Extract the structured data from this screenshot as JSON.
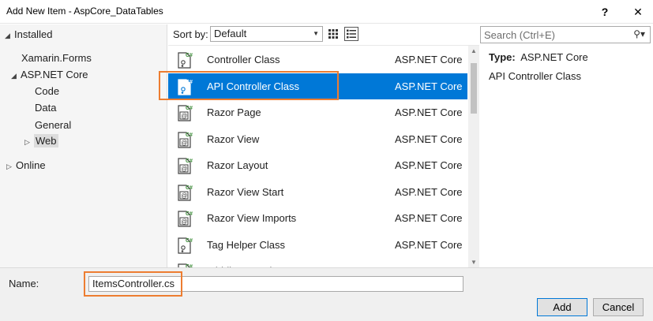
{
  "window": {
    "title": "Add New Item - AspCore_DataTables",
    "help_label": "?",
    "close_label": "✕"
  },
  "tree": {
    "installed": "Installed",
    "items": [
      "Xamarin.Forms",
      "ASP.NET Core",
      "Code",
      "Data",
      "General",
      "Web"
    ],
    "selected": "Web",
    "online": "Online"
  },
  "toolbar": {
    "sort_label": "Sort by:",
    "sort_value": "Default",
    "search_placeholder": "Search (Ctrl+E)"
  },
  "templates": [
    {
      "name": "Controller Class",
      "category": "ASP.NET Core",
      "icon": "csharp-class-icon"
    },
    {
      "name": "API Controller Class",
      "category": "ASP.NET Core",
      "icon": "csharp-class-icon",
      "selected": true
    },
    {
      "name": "Razor Page",
      "category": "ASP.NET Core",
      "icon": "razor-file-icon"
    },
    {
      "name": "Razor View",
      "category": "ASP.NET Core",
      "icon": "razor-file-icon"
    },
    {
      "name": "Razor Layout",
      "category": "ASP.NET Core",
      "icon": "razor-file-icon"
    },
    {
      "name": "Razor View Start",
      "category": "ASP.NET Core",
      "icon": "razor-file-icon"
    },
    {
      "name": "Razor View Imports",
      "category": "ASP.NET Core",
      "icon": "razor-file-icon"
    },
    {
      "name": "Tag Helper Class",
      "category": "ASP.NET Core",
      "icon": "csharp-class-icon"
    },
    {
      "name": "Middleware Class",
      "category": "ASP.NET Core",
      "icon": "csharp-class-icon"
    }
  ],
  "details": {
    "type_label": "Type:",
    "type_value": "ASP.NET Core",
    "description": "API Controller Class"
  },
  "footer": {
    "name_label": "Name:",
    "name_value": "ItemsController.cs",
    "add_label": "Add",
    "cancel_label": "Cancel"
  },
  "colors": {
    "selection": "#0078d7",
    "highlight_outline": "#ed7d31"
  }
}
